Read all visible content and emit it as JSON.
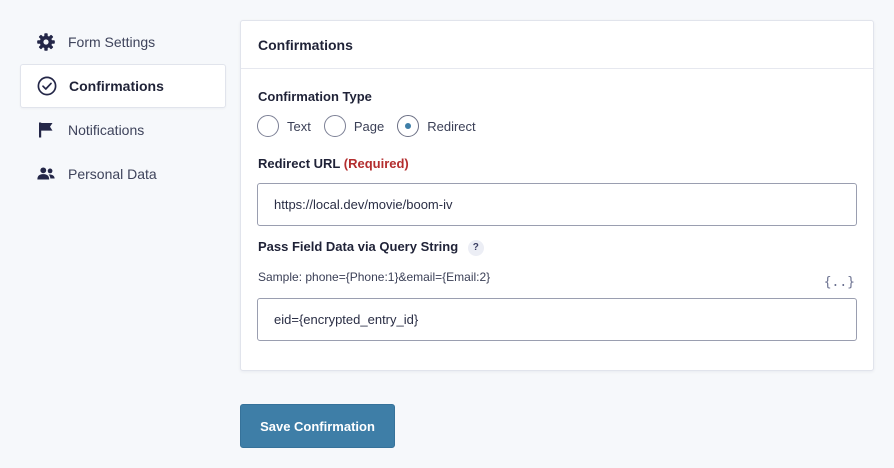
{
  "sidebar": {
    "items": [
      {
        "label": "Form Settings",
        "icon": "gear-icon"
      },
      {
        "label": "Confirmations",
        "icon": "check-circle-icon",
        "active": true
      },
      {
        "label": "Notifications",
        "icon": "flag-icon"
      },
      {
        "label": "Personal Data",
        "icon": "users-icon"
      }
    ]
  },
  "panel": {
    "title": "Confirmations",
    "confirmation_type": {
      "label": "Confirmation Type",
      "options": [
        "Text",
        "Page",
        "Redirect"
      ],
      "selected": "Redirect"
    },
    "redirect_url": {
      "label": "Redirect URL",
      "required": "(Required)",
      "value": "https://local.dev/movie/boom-iv"
    },
    "query_string": {
      "label": "Pass Field Data via Query String",
      "help": "?",
      "sample": "Sample: phone={Phone:1}&email={Email:2}",
      "merge_tag": "{..}",
      "value": "eid={encrypted_entry_id}"
    }
  },
  "save_button": {
    "label": "Save Confirmation"
  },
  "colors": {
    "accent": "#3e7ea7",
    "required": "#b32d2e",
    "background": "#f6f8fb"
  }
}
